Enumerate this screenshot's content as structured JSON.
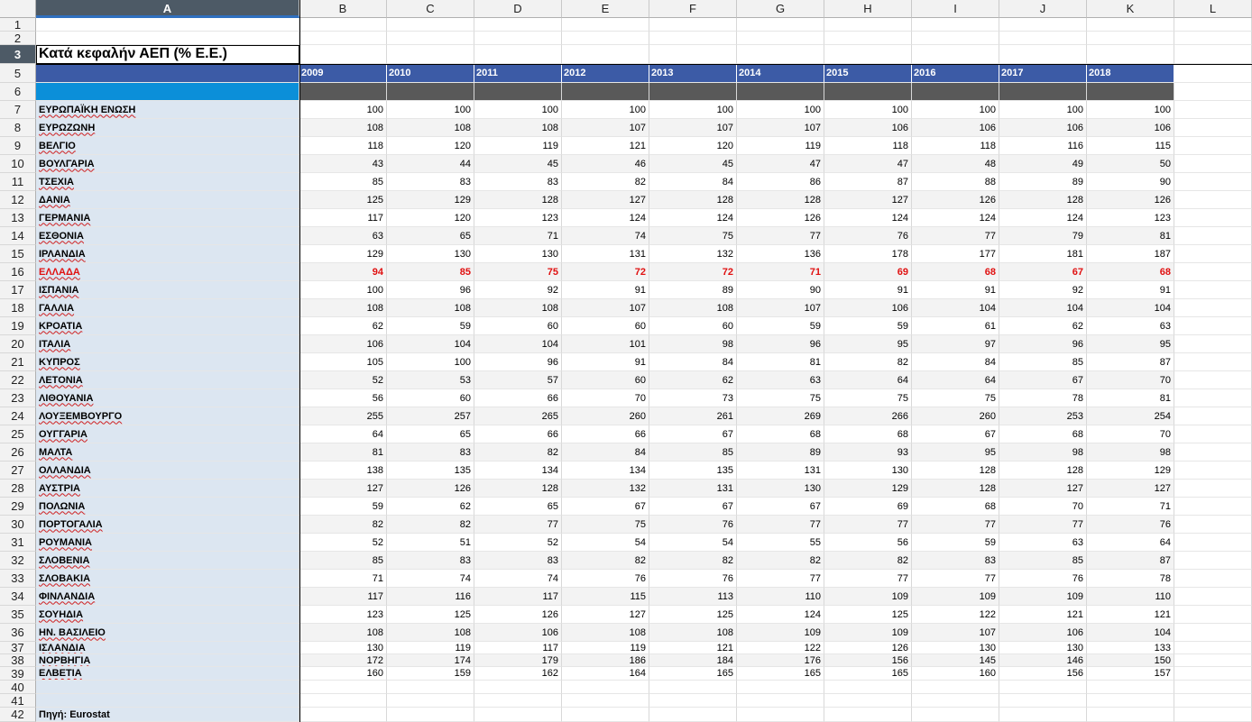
{
  "columns": [
    "A",
    "B",
    "C",
    "D",
    "E",
    "F",
    "G",
    "H",
    "I",
    "J",
    "K",
    "L"
  ],
  "selected_column": "A",
  "selected_row": "3",
  "title": "Κατά κεφαλήν ΑΕΠ (% Ε.Ε.)",
  "years": [
    "2009",
    "2010",
    "2011",
    "2012",
    "2013",
    "2014",
    "2015",
    "2016",
    "2017",
    "2018"
  ],
  "source": "Πηγή: Eurostat",
  "colors": {
    "year_header": "#3c5ba6",
    "band": "#0b8fd9",
    "dark_band": "#595959",
    "label_bg": "#dce6f1",
    "highlight": "#e01010"
  },
  "table": [
    {
      "row": "7",
      "label": "ΕΥΡΩΠΑΪΚΗ ΕΝΩΣΗ",
      "values": [
        "100",
        "100",
        "100",
        "100",
        "100",
        "100",
        "100",
        "100",
        "100",
        "100"
      ]
    },
    {
      "row": "8",
      "label": "ΕΥΡΩΖΩΝΗ",
      "values": [
        "108",
        "108",
        "108",
        "107",
        "107",
        "107",
        "106",
        "106",
        "106",
        "106"
      ]
    },
    {
      "row": "9",
      "label": "ΒΕΛΓΙΟ",
      "values": [
        "118",
        "120",
        "119",
        "121",
        "120",
        "119",
        "118",
        "118",
        "116",
        "115"
      ]
    },
    {
      "row": "10",
      "label": "ΒΟΥΛΓΑΡΙΑ",
      "values": [
        "43",
        "44",
        "45",
        "46",
        "45",
        "47",
        "47",
        "48",
        "49",
        "50"
      ]
    },
    {
      "row": "11",
      "label": "ΤΣΕΧΙΑ",
      "values": [
        "85",
        "83",
        "83",
        "82",
        "84",
        "86",
        "87",
        "88",
        "89",
        "90"
      ]
    },
    {
      "row": "12",
      "label": "ΔΑΝΙΑ",
      "values": [
        "125",
        "129",
        "128",
        "127",
        "128",
        "128",
        "127",
        "126",
        "128",
        "126"
      ]
    },
    {
      "row": "13",
      "label": "ΓΕΡΜΑΝΙΑ",
      "values": [
        "117",
        "120",
        "123",
        "124",
        "124",
        "126",
        "124",
        "124",
        "124",
        "123"
      ]
    },
    {
      "row": "14",
      "label": "ΕΣΘΟΝΙΑ",
      "values": [
        "63",
        "65",
        "71",
        "74",
        "75",
        "77",
        "76",
        "77",
        "79",
        "81"
      ]
    },
    {
      "row": "15",
      "label": "ΙΡΛΑΝΔΙΑ",
      "values": [
        "129",
        "130",
        "130",
        "131",
        "132",
        "136",
        "178",
        "177",
        "181",
        "187"
      ]
    },
    {
      "row": "16",
      "label": "ΕΛΛΑΔΑ",
      "values": [
        "94",
        "85",
        "75",
        "72",
        "72",
        "71",
        "69",
        "68",
        "67",
        "68"
      ],
      "highlight": true
    },
    {
      "row": "17",
      "label": "ΙΣΠΑΝΙΑ",
      "values": [
        "100",
        "96",
        "92",
        "91",
        "89",
        "90",
        "91",
        "91",
        "92",
        "91"
      ]
    },
    {
      "row": "18",
      "label": "ΓΑΛΛΙΑ",
      "values": [
        "108",
        "108",
        "108",
        "107",
        "108",
        "107",
        "106",
        "104",
        "104",
        "104"
      ]
    },
    {
      "row": "19",
      "label": "ΚΡΟΑΤΙΑ",
      "values": [
        "62",
        "59",
        "60",
        "60",
        "60",
        "59",
        "59",
        "61",
        "62",
        "63"
      ]
    },
    {
      "row": "20",
      "label": "ΙΤΑΛΙΑ",
      "values": [
        "106",
        "104",
        "104",
        "101",
        "98",
        "96",
        "95",
        "97",
        "96",
        "95"
      ]
    },
    {
      "row": "21",
      "label": "ΚΥΠΡΟΣ",
      "values": [
        "105",
        "100",
        "96",
        "91",
        "84",
        "81",
        "82",
        "84",
        "85",
        "87"
      ]
    },
    {
      "row": "22",
      "label": "ΛΕΤΟΝΙΑ",
      "values": [
        "52",
        "53",
        "57",
        "60",
        "62",
        "63",
        "64",
        "64",
        "67",
        "70"
      ]
    },
    {
      "row": "23",
      "label": "ΛΙΘΟΥΑΝΙΑ",
      "values": [
        "56",
        "60",
        "66",
        "70",
        "73",
        "75",
        "75",
        "75",
        "78",
        "81"
      ]
    },
    {
      "row": "24",
      "label": "ΛΟΥΞΕΜΒΟΥΡΓΟ",
      "values": [
        "255",
        "257",
        "265",
        "260",
        "261",
        "269",
        "266",
        "260",
        "253",
        "254"
      ]
    },
    {
      "row": "25",
      "label": "ΟΥΓΓΑΡΙΑ",
      "values": [
        "64",
        "65",
        "66",
        "66",
        "67",
        "68",
        "68",
        "67",
        "68",
        "70"
      ]
    },
    {
      "row": "26",
      "label": "ΜΑΛΤΑ",
      "values": [
        "81",
        "83",
        "82",
        "84",
        "85",
        "89",
        "93",
        "95",
        "98",
        "98"
      ]
    },
    {
      "row": "27",
      "label": "ΟΛΛΑΝΔΙΑ",
      "values": [
        "138",
        "135",
        "134",
        "134",
        "135",
        "131",
        "130",
        "128",
        "128",
        "129"
      ]
    },
    {
      "row": "28",
      "label": "ΑΥΣΤΡΙΑ",
      "values": [
        "127",
        "126",
        "128",
        "132",
        "131",
        "130",
        "129",
        "128",
        "127",
        "127"
      ]
    },
    {
      "row": "29",
      "label": "ΠΟΛΩΝΙΑ",
      "values": [
        "59",
        "62",
        "65",
        "67",
        "67",
        "67",
        "69",
        "68",
        "70",
        "71"
      ]
    },
    {
      "row": "30",
      "label": "ΠΟΡΤΟΓΑΛΙΑ",
      "values": [
        "82",
        "82",
        "77",
        "75",
        "76",
        "77",
        "77",
        "77",
        "77",
        "76"
      ]
    },
    {
      "row": "31",
      "label": "ΡΟΥΜΑΝΙΑ",
      "values": [
        "52",
        "51",
        "52",
        "54",
        "54",
        "55",
        "56",
        "59",
        "63",
        "64"
      ]
    },
    {
      "row": "32",
      "label": "ΣΛΟΒΕΝΙΑ",
      "values": [
        "85",
        "83",
        "83",
        "82",
        "82",
        "82",
        "82",
        "83",
        "85",
        "87"
      ]
    },
    {
      "row": "33",
      "label": "ΣΛΟΒΑΚΙΑ",
      "values": [
        "71",
        "74",
        "74",
        "76",
        "76",
        "77",
        "77",
        "77",
        "76",
        "78"
      ]
    },
    {
      "row": "34",
      "label": "ΦΙΝΛΑΝΔΙΑ",
      "values": [
        "117",
        "116",
        "117",
        "115",
        "113",
        "110",
        "109",
        "109",
        "109",
        "110"
      ]
    },
    {
      "row": "35",
      "label": "ΣΟΥΗΔΙΑ",
      "values": [
        "123",
        "125",
        "126",
        "127",
        "125",
        "124",
        "125",
        "122",
        "121",
        "121"
      ]
    },
    {
      "row": "36",
      "label": "ΗΝ. ΒΑΣΙΛΕΙΟ",
      "values": [
        "108",
        "108",
        "106",
        "108",
        "108",
        "109",
        "109",
        "107",
        "106",
        "104"
      ]
    },
    {
      "row": "37",
      "label": "ΙΣΛΑΝΔΙΑ",
      "values": [
        "130",
        "119",
        "117",
        "119",
        "121",
        "122",
        "126",
        "130",
        "130",
        "133"
      ]
    },
    {
      "row": "38",
      "label": "ΝΟΡΒΗΓΙΑ",
      "values": [
        "172",
        "174",
        "179",
        "186",
        "184",
        "176",
        "156",
        "145",
        "146",
        "150"
      ]
    },
    {
      "row": "39",
      "label": "ΕΛΒΕΤΙΑ",
      "values": [
        "160",
        "159",
        "162",
        "164",
        "165",
        "165",
        "165",
        "160",
        "156",
        "157"
      ]
    }
  ]
}
